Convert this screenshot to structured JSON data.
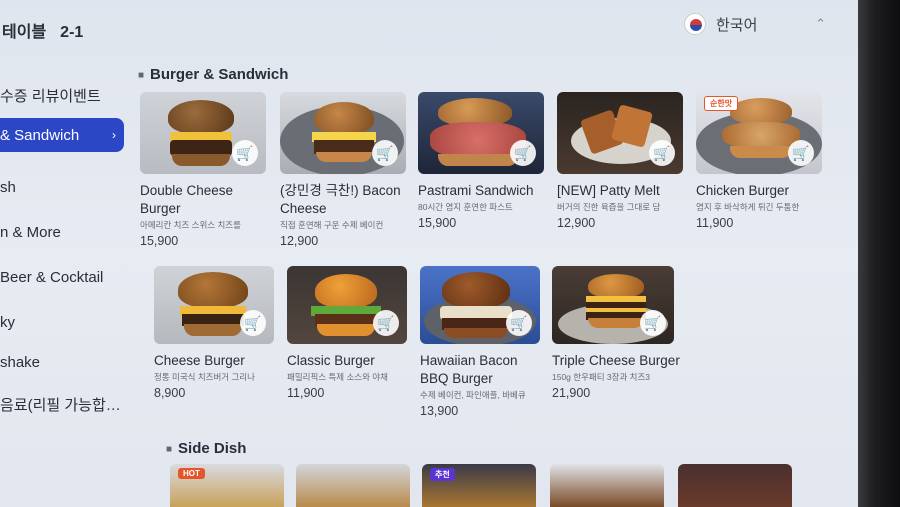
{
  "header": {
    "table_label": "테이블",
    "table_number": "2-1",
    "language": "한국어"
  },
  "sidebar": {
    "items": [
      {
        "label": "수증 리뷰이벤트",
        "active": false
      },
      {
        "label": "& Sandwich",
        "active": true
      },
      {
        "label": "sh",
        "active": false
      },
      {
        "label": "n & More",
        "active": false
      },
      {
        "label": "Beer & Cocktail",
        "active": false
      },
      {
        "label": "ky",
        "active": false
      },
      {
        "label": "shake",
        "active": false
      },
      {
        "label": "음료(리필 가능합…",
        "active": false
      }
    ]
  },
  "sections": {
    "burger_title": "Burger & Sandwich",
    "side_title": "Side Dish"
  },
  "products": [
    {
      "name": "Double Cheese Burger",
      "desc": "아메리칸 치즈 스위스 치즈를",
      "price": "15,900",
      "tag": ""
    },
    {
      "name": "(강민경 극찬!) Bacon Cheese",
      "desc": "직접 훈연해 구운 수제 베이컨",
      "price": "12,900",
      "tag": ""
    },
    {
      "name": "Pastrami Sandwich",
      "desc": "80시간 염지 훈연한 파스트",
      "price": "15,900",
      "tag": ""
    },
    {
      "name": "[NEW] Patty Melt",
      "desc": "버거의 진한 육즙을 그대로 담",
      "price": "12,900",
      "tag": ""
    },
    {
      "name": "Chicken Burger",
      "desc": "염지 후 바삭하게 튀긴 두툼한",
      "price": "11,900",
      "tag": "순한맛"
    },
    {
      "name": "Cheese Burger",
      "desc": "정통 미국식 치즈버거 그리나",
      "price": "8,900",
      "tag": ""
    },
    {
      "name": "Classic Burger",
      "desc": "패밀리픽스 특제 소스와 야채",
      "price": "11,900",
      "tag": ""
    },
    {
      "name": "Hawaiian Bacon BBQ Burger",
      "desc": "수제 베이컨, 파인애플, 바베큐",
      "price": "13,900",
      "tag": ""
    },
    {
      "name": "Triple Cheese Burger",
      "desc": "150g 한우패티 3장과 치즈3",
      "price": "21,900",
      "tag": ""
    }
  ],
  "side_dishes": [
    {
      "tag": "HOT"
    },
    {
      "tag": ""
    },
    {
      "tag": "추천"
    },
    {
      "tag": ""
    },
    {
      "tag": ""
    }
  ],
  "icons": {
    "cart": "cart-icon",
    "flag": "korea-flag-icon",
    "chevron": "chevron-down-icon"
  },
  "colors": {
    "accent": "#2c47c5",
    "hot_tag": "#e4552b",
    "recommend_tag": "#5b35d4"
  }
}
